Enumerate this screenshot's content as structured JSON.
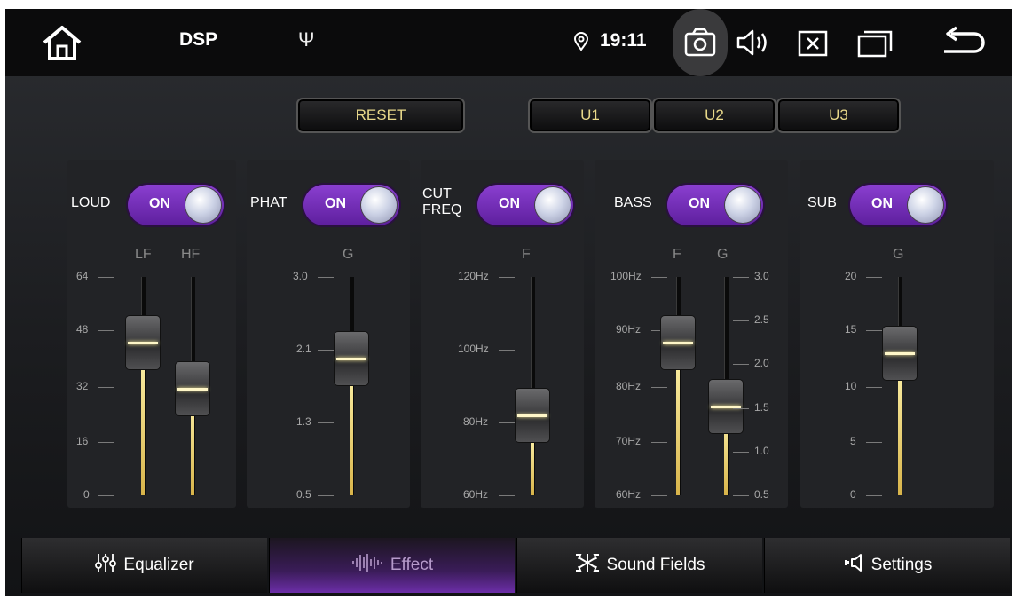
{
  "topbar": {
    "title": "DSP",
    "usb_symbol": "Ψ",
    "time": "19:11",
    "icons": [
      "home-icon",
      "usb-icon",
      "location-icon",
      "camera-icon",
      "volume-icon",
      "close-box-icon",
      "recent-apps-icon",
      "back-icon"
    ]
  },
  "controls": {
    "reset": "RESET",
    "presets": [
      "U1",
      "U2",
      "U3"
    ]
  },
  "toggle_label": "ON",
  "panels": [
    {
      "label": "LOUD",
      "toggle": "ON",
      "channels": [
        "LF",
        "HF"
      ],
      "ticks": [
        "64",
        "48",
        "32",
        "16",
        "0"
      ],
      "values": {
        "LF": 45,
        "HF": 30
      }
    },
    {
      "label": "PHAT",
      "toggle": "ON",
      "channels": [
        "G"
      ],
      "ticks": [
        "3.0",
        "2.1",
        "1.3",
        "0.5"
      ],
      "values": {
        "G": 2.0
      }
    },
    {
      "label": "CUT FREQ",
      "toggle": "ON",
      "channels": [
        "F"
      ],
      "ticks": [
        "120Hz",
        "100Hz",
        "80Hz",
        "60Hz"
      ],
      "values": {
        "F": "80Hz"
      }
    },
    {
      "label": "BASS",
      "toggle": "ON",
      "channels": [
        "F",
        "G"
      ],
      "ticks_left": [
        "100Hz",
        "90Hz",
        "80Hz",
        "70Hz",
        "60Hz"
      ],
      "ticks_right": [
        "3.0",
        "2.5",
        "2.0",
        "1.5",
        "1.0",
        "0.5"
      ],
      "values": {
        "F": "90Hz",
        "G": 1.5
      }
    },
    {
      "label": "SUB",
      "toggle": "ON",
      "channels": [
        "G"
      ],
      "ticks": [
        "20",
        "15",
        "10",
        "5",
        "0"
      ],
      "values": {
        "G": 13
      }
    }
  ],
  "tabs": [
    {
      "label": "Equalizer",
      "icon": "equalizer-icon",
      "active": false
    },
    {
      "label": "Effect",
      "icon": "effect-icon",
      "active": true
    },
    {
      "label": "Sound Fields",
      "icon": "sound-fields-icon",
      "active": false
    },
    {
      "label": "Settings",
      "icon": "settings-speaker-icon",
      "active": false
    }
  ],
  "colors": {
    "accent": "#7b35c4",
    "thumb_line": "#fff7c8",
    "fill": "#e8cc6a",
    "button_text": "#e9d98a"
  }
}
